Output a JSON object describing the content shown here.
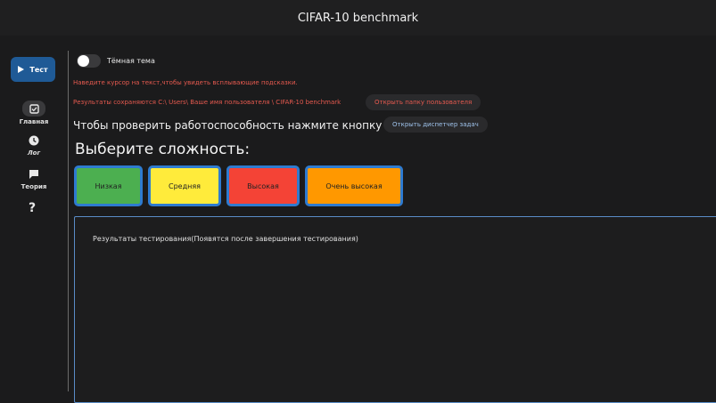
{
  "app": {
    "title": "CIFAR-10 benchmark"
  },
  "sidebar": {
    "test_button": "Тест",
    "items": [
      {
        "label": "Главная",
        "icon": "check-box-icon",
        "active": true
      },
      {
        "label": "Лог",
        "icon": "history-icon",
        "active": false
      },
      {
        "label": "Теория",
        "icon": "chat-icon",
        "active": false
      }
    ],
    "help": "?"
  },
  "settings": {
    "dark_theme_label": "Тёмная тема",
    "dark_theme_on": false
  },
  "info": {
    "hint": "Наведите курсор на текст,чтобы увидеть всплывающие подсказки.",
    "saved_path": "Результаты сохраняются C:\\ Users\\ Ваше имя пользователя \\ CIFAR-10 benchmark",
    "open_folder": "Открыть папку пользователя",
    "check_text": "Чтобы проверить работоспособность нажмите кнопку тест.",
    "open_taskmgr": "Открыть диспетчер задач"
  },
  "difficulty": {
    "heading": "Выберите сложность:",
    "options": [
      {
        "label": "Низкая",
        "color": "#4caf50"
      },
      {
        "label": "Средняя",
        "color": "#ffeb3b"
      },
      {
        "label": "Высокая",
        "color": "#f44336"
      },
      {
        "label": "Очень высокая",
        "color": "#ff9800"
      }
    ]
  },
  "results": {
    "text": "Результаты тестирования(Появятся после завершения тестирования)"
  },
  "colors": {
    "accent": "#1f5a96",
    "warning_text": "#e65a4f",
    "link_text": "#9fc3ec",
    "border_blue": "#2e7bd0"
  }
}
